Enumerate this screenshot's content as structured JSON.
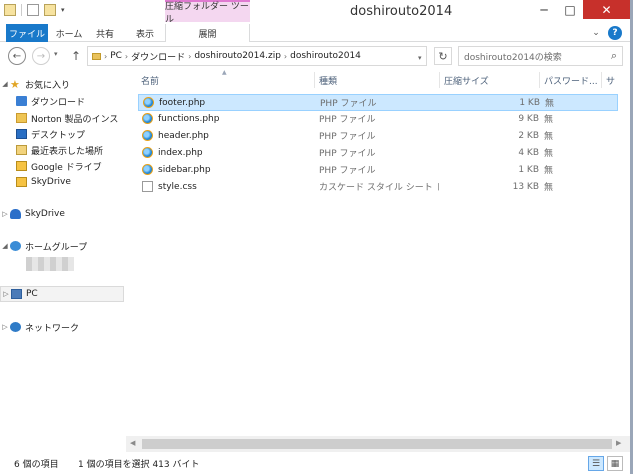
{
  "window": {
    "title": "doshirouto2014",
    "context_tab_header": "圧縮フォルダー ツール",
    "minimize": "─",
    "maximize": "□",
    "close": "✕"
  },
  "ribbon": {
    "file": "ファイル",
    "home": "ホーム",
    "share": "共有",
    "view": "表示",
    "extract": "展開",
    "expand_icon": "chevron-down-icon",
    "help_icon": "help-icon",
    "expand_glyph": "⌄",
    "help_glyph": "?"
  },
  "nav": {
    "back_glyph": "←",
    "forward_glyph": "→",
    "recent_glyph": "▾",
    "up_glyph": "↑",
    "refresh_glyph": "↻",
    "search_glyph": "⌕",
    "breadcrumb": [
      "PC",
      "ダウンロード",
      "doshirouto2014.zip",
      "doshirouto2014"
    ],
    "search_placeholder": "doshirouto2014の検索"
  },
  "navpane": {
    "favorites": "お気に入り",
    "favorites_items": [
      "ダウンロード",
      "Norton 製品のインス",
      "デスクトップ",
      "最近表示した場所",
      "Google ドライブ",
      "SkyDrive"
    ],
    "skydrive": "SkyDrive",
    "homegroup": "ホームグループ",
    "pc": "PC",
    "network": "ネットワーク"
  },
  "filelist": {
    "columns": {
      "name": "名前",
      "type": "種類",
      "size": "圧縮サイズ",
      "password": "パスワード...",
      "more": "サ"
    },
    "rows": [
      {
        "name": "footer.php",
        "type": "PHP ファイル",
        "size": "1 KB",
        "pw": "無",
        "icon": "php-file-icon"
      },
      {
        "name": "functions.php",
        "type": "PHP ファイル",
        "size": "9 KB",
        "pw": "無",
        "icon": "php-file-icon"
      },
      {
        "name": "header.php",
        "type": "PHP ファイル",
        "size": "2 KB",
        "pw": "無",
        "icon": "php-file-icon"
      },
      {
        "name": "index.php",
        "type": "PHP ファイル",
        "size": "4 KB",
        "pw": "無",
        "icon": "php-file-icon"
      },
      {
        "name": "sidebar.php",
        "type": "PHP ファイル",
        "size": "1 KB",
        "pw": "無",
        "icon": "php-file-icon"
      },
      {
        "name": "style.css",
        "type": "カスケード スタイル シート ド...",
        "size": "13 KB",
        "pw": "無",
        "icon": "css-file-icon"
      }
    ],
    "selected_index": 0
  },
  "statusbar": {
    "count": "6 個の項目",
    "selection": "1 個の項目を選択  413 バイト",
    "details_glyph": "☰",
    "tiles_glyph": "▦"
  },
  "colors": {
    "accent": "#1979ca",
    "selection_bg": "#cce8ff",
    "selection_border": "#99d1ff",
    "context_tab": "#f4d7f0",
    "close": "#c7302b"
  }
}
